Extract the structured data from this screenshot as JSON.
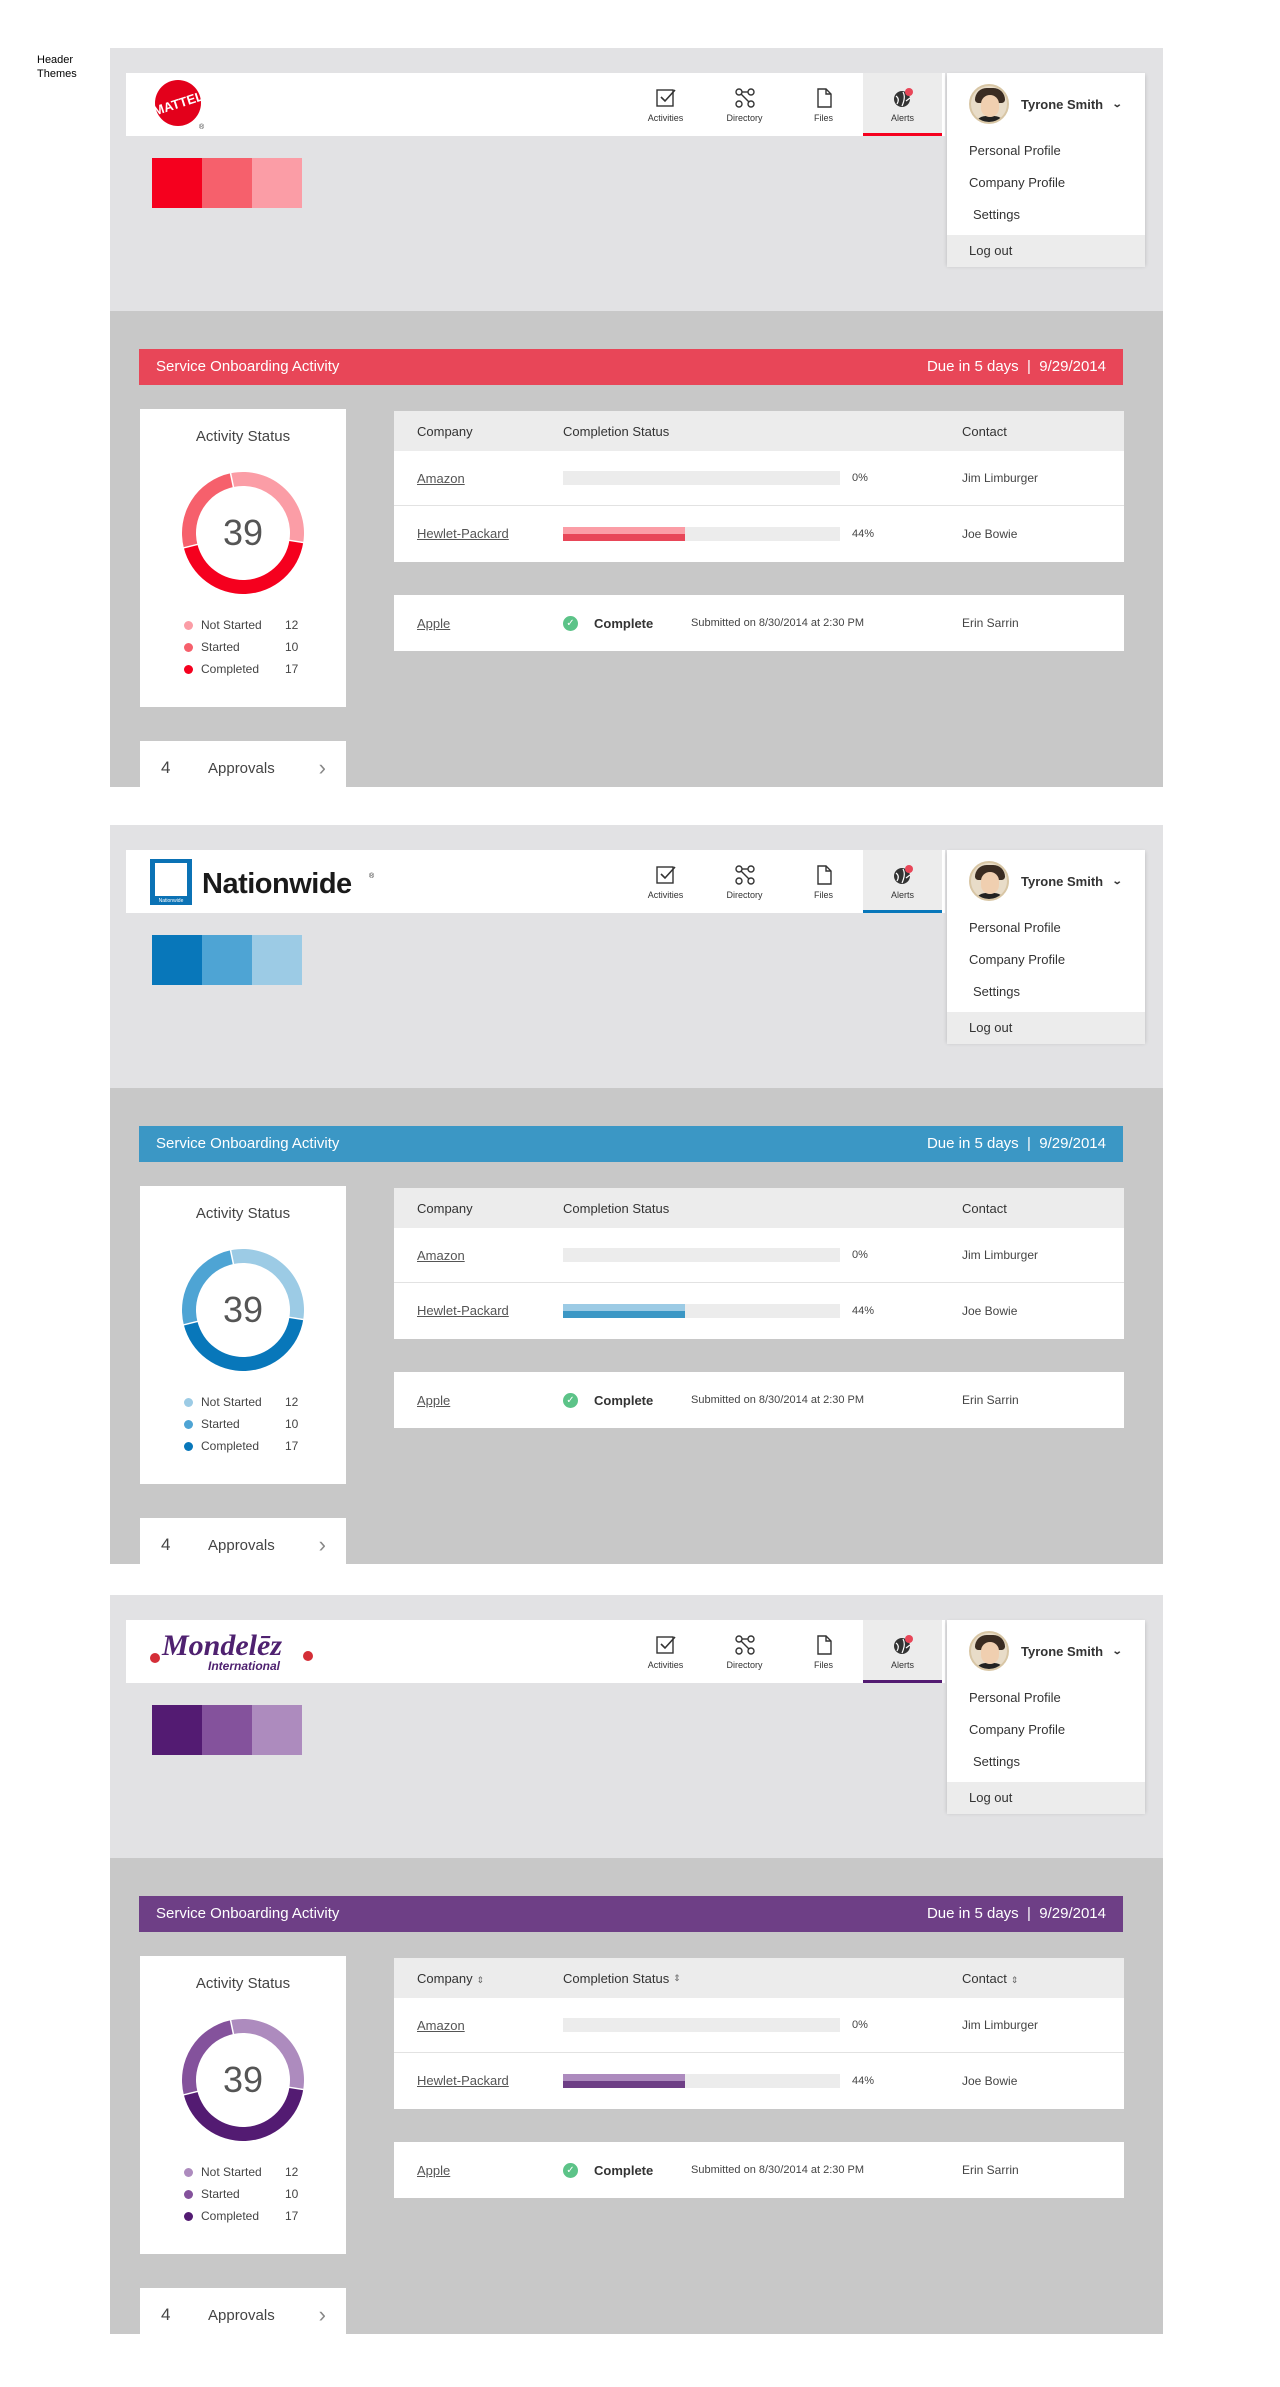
{
  "page_label": "Header\nThemes",
  "themes": [
    {
      "brand": "MATTEL",
      "colors": {
        "c1": "#f5001e",
        "c2": "#e84658",
        "c3": "#fb9da6"
      },
      "nav": [
        "Activities",
        "Directory",
        "Files",
        "Alerts"
      ],
      "user": {
        "name": "Tyrone Smith",
        "menu": [
          "Personal Profile",
          "Company Profile",
          "Settings",
          "Log out"
        ]
      },
      "swatches": [
        "#f5001e",
        "#f6606c",
        "#fb9da6"
      ],
      "banner": {
        "title": "Service Onboarding Activity",
        "due": "Due in 5 days",
        "date": "9/29/2014"
      },
      "status": {
        "title": "Activity Status",
        "total": "39",
        "not_started": {
          "label": "Not Started",
          "count": "12",
          "color": "#fb9da6"
        },
        "started": {
          "label": "Started",
          "count": "10",
          "color": "#f6606c"
        },
        "completed": {
          "label": "Completed",
          "count": "17",
          "color": "#f5001e"
        }
      },
      "approvals": {
        "count": "4",
        "label": "Approvals"
      },
      "table": {
        "headers": [
          "Company",
          "Completion Status",
          "Contact"
        ],
        "sortable": false,
        "rows": [
          {
            "company": "Amazon",
            "progress": 0,
            "pct": "0%",
            "contact": "Jim Limburger"
          },
          {
            "company": "Hewlet-Packard",
            "progress": 0.44,
            "pct": "44%",
            "contact": "Joe Bowie"
          }
        ]
      },
      "complete_row": {
        "company": "Apple",
        "status": "Complete",
        "submitted": "Submitted on 8/30/2014 at 2:30 PM",
        "contact": "Erin Sarrin"
      }
    },
    {
      "brand": "Nationwide",
      "colors": {
        "c1": "#0877ba",
        "c2": "#3b97c5",
        "c3": "#9ccbe5"
      },
      "nav": [
        "Activities",
        "Directory",
        "Files",
        "Alerts"
      ],
      "user": {
        "name": "Tyrone Smith",
        "menu": [
          "Personal Profile",
          "Company Profile",
          "Settings",
          "Log out"
        ]
      },
      "swatches": [
        "#0877ba",
        "#4ea4d4",
        "#9ccbe5"
      ],
      "banner": {
        "title": "Service Onboarding Activity",
        "due": "Due in 5 days",
        "date": "9/29/2014"
      },
      "status": {
        "title": "Activity Status",
        "total": "39",
        "not_started": {
          "label": "Not Started",
          "count": "12",
          "color": "#9ccbe5"
        },
        "started": {
          "label": "Started",
          "count": "10",
          "color": "#4ea4d4"
        },
        "completed": {
          "label": "Completed",
          "count": "17",
          "color": "#0877ba"
        }
      },
      "approvals": {
        "count": "4",
        "label": "Approvals"
      },
      "table": {
        "headers": [
          "Company",
          "Completion Status",
          "Contact"
        ],
        "sortable": false,
        "rows": [
          {
            "company": "Amazon",
            "progress": 0,
            "pct": "0%",
            "contact": "Jim Limburger"
          },
          {
            "company": "Hewlet-Packard",
            "progress": 0.44,
            "pct": "44%",
            "contact": "Joe Bowie"
          }
        ]
      },
      "complete_row": {
        "company": "Apple",
        "status": "Complete",
        "submitted": "Submitted on 8/30/2014 at 2:30 PM",
        "contact": "Erin Sarrin"
      }
    },
    {
      "brand": "Mondelēz International",
      "colors": {
        "c1": "#531b72",
        "c2": "#6e3f86",
        "c3": "#ad8bbe"
      },
      "nav": [
        "Activities",
        "Directory",
        "Files",
        "Alerts"
      ],
      "user": {
        "name": "Tyrone Smith",
        "menu": [
          "Personal Profile",
          "Company Profile",
          "Settings",
          "Log out"
        ]
      },
      "swatches": [
        "#531b72",
        "#84529c",
        "#ad8bbe"
      ],
      "banner": {
        "title": "Service Onboarding Activity",
        "due": "Due in 5 days",
        "date": "9/29/2014"
      },
      "status": {
        "title": "Activity Status",
        "total": "39",
        "not_started": {
          "label": "Not Started",
          "count": "12",
          "color": "#ad8bbe"
        },
        "started": {
          "label": "Started",
          "count": "10",
          "color": "#84529c"
        },
        "completed": {
          "label": "Completed",
          "count": "17",
          "color": "#531b72"
        }
      },
      "approvals": {
        "count": "4",
        "label": "Approvals"
      },
      "table": {
        "headers": [
          "Company",
          "Completion Status",
          "Contact"
        ],
        "sortable": true,
        "rows": [
          {
            "company": "Amazon",
            "progress": 0,
            "pct": "0%",
            "contact": "Jim Limburger"
          },
          {
            "company": "Hewlet-Packard",
            "progress": 0.44,
            "pct": "44%",
            "contact": "Joe Bowie"
          }
        ]
      },
      "complete_row": {
        "company": "Apple",
        "status": "Complete",
        "submitted": "Submitted on 8/30/2014 at 2:30 PM",
        "contact": "Erin Sarrin"
      }
    }
  ]
}
